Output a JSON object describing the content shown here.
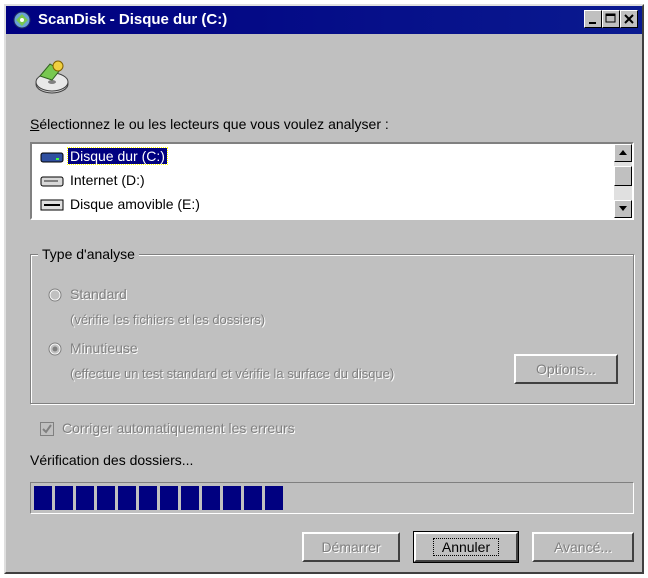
{
  "window": {
    "title": "ScanDisk - Disque dur (C:)"
  },
  "prompt": {
    "underlined": "S",
    "rest": "électionnez le ou les lecteurs que vous voulez analyser :"
  },
  "drives": [
    {
      "label": "Disque dur (C:)",
      "icon": "hard-drive-icon",
      "selected": true
    },
    {
      "label": "Internet (D:)",
      "icon": "network-drive-icon",
      "selected": false
    },
    {
      "label": "Disque amovible (E:)",
      "icon": "removable-drive-icon",
      "selected": false
    }
  ],
  "analysis_type": {
    "legend": "Type d'analyse",
    "standard_label": "Standard",
    "standard_desc": "(vérifie les fichiers et les dossiers)",
    "thorough_label": "Minutieuse",
    "thorough_desc": "(effectue un test standard et vérifie la surface du disque)",
    "options_button": "Options..."
  },
  "auto_fix": {
    "label": "Corriger automatiquement les erreurs",
    "checked": true
  },
  "status": {
    "text": "Vérification des dossiers...",
    "progress_fraction": 0.42
  },
  "buttons": {
    "start": "Démarrer",
    "cancel": "Annuler",
    "advanced": "Avancé..."
  },
  "colors": {
    "titlebar": "#000080",
    "face": "#c0c0c0",
    "progress": "#000080"
  }
}
